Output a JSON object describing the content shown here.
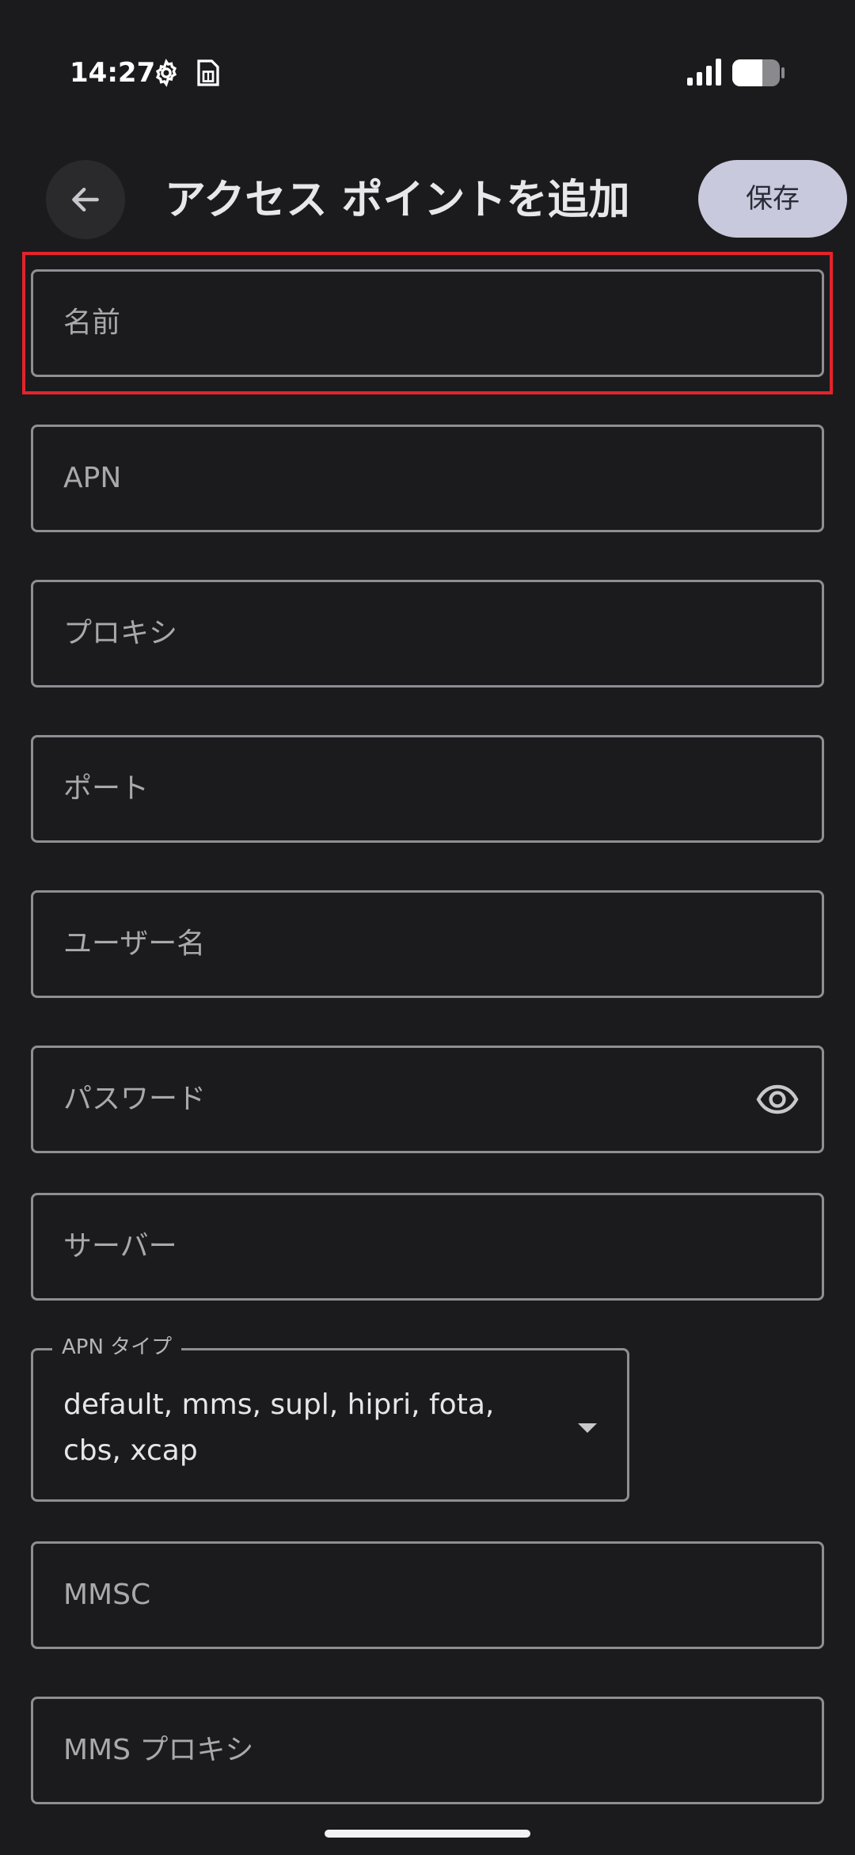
{
  "status_bar": {
    "time": "14:27",
    "icons": [
      "gear-icon",
      "sim-card-icon",
      "signal-icon",
      "battery-icon"
    ]
  },
  "app_bar": {
    "back_icon": "arrow-left-icon",
    "title": "アクセス ポイントを追加",
    "save_label": "保存"
  },
  "fields": [
    {
      "placeholder": "名前",
      "highlighted": true
    },
    {
      "placeholder": "APN"
    },
    {
      "placeholder": "プロキシ"
    },
    {
      "placeholder": "ポート"
    },
    {
      "placeholder": "ユーザー名"
    },
    {
      "placeholder": "パスワード",
      "trailing_icon": "eye-icon"
    },
    {
      "placeholder": "サーバー"
    },
    {
      "placeholder": "MMSC"
    },
    {
      "placeholder": "MMS プロキシ"
    }
  ],
  "apn_type": {
    "label": "APN タイプ",
    "value": "default, mms, supl, hipri, fota, cbs, xcap",
    "icon": "dropdown-arrow-icon"
  },
  "colors": {
    "background": "#1b1b1d",
    "field_border": "#8e8e93",
    "save_button": "#c8c9dc",
    "highlight": "#e3242b"
  }
}
